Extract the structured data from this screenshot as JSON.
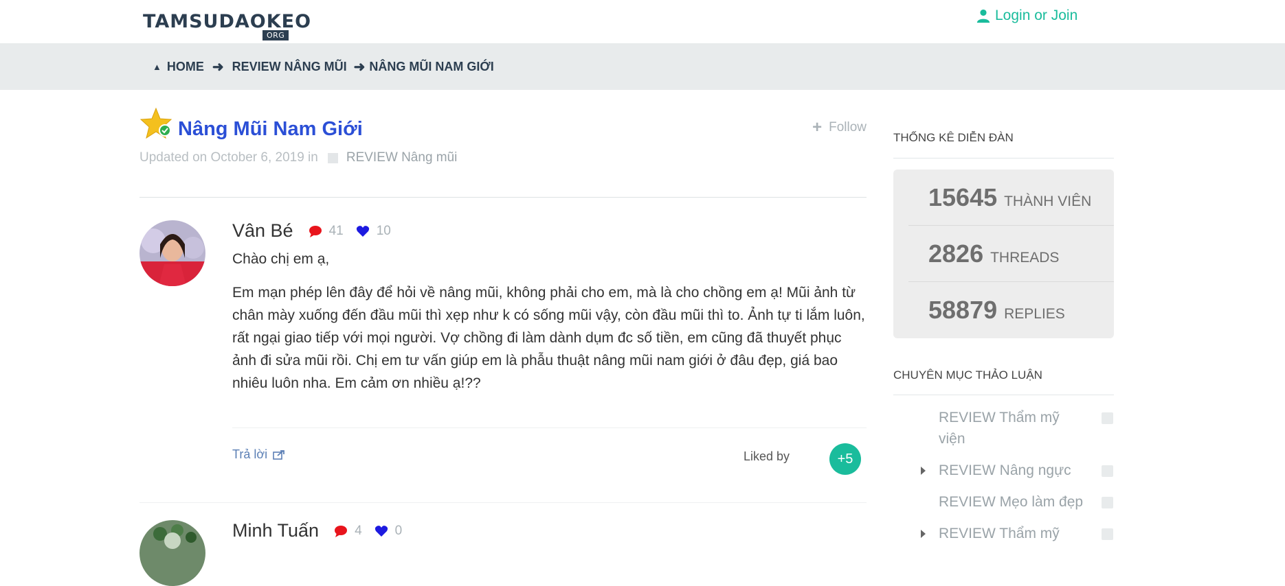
{
  "header": {
    "logo_main": "TAMSUDAOKEO",
    "logo_sub": "ORG",
    "login_label": "Login or Join",
    "accent_color": "#1abc9c"
  },
  "breadcrumb": {
    "items": [
      "HOME",
      "REVIEW Nâng mũi",
      "NÂNG MŨI NAM GIỚI"
    ]
  },
  "topic": {
    "title": "Nâng Mũi Nam Giới",
    "follow_label": "Follow",
    "updated_prefix": "Updated on October 6, 2019 in",
    "category": "REVIEW Nâng mũi"
  },
  "posts": [
    {
      "author": "Vân Bé",
      "comments": "41",
      "likes": "10",
      "greeting": "Chào chị em ạ,",
      "body": "Em mạn phép lên đây để hỏi về nâng mũi, không phải cho em, mà là cho chồng em ạ! Mũi ảnh từ chân mày xuống đến đầu mũi thì xẹp như k có sống mũi vậy, còn đầu mũi thì to. Ảnh tự ti lắm luôn, rất ngại giao tiếp với mọi người. Vợ chồng đi làm dành dụm đc số tiền, em cũng đã thuyết phục ảnh đi sửa mũi rồi. Chị em tư vấn giúp em là phẫu thuật nâng mũi nam giới ở đâu đẹp, giá bao nhiêu luôn nha. Em cảm ơn nhiều ạ!??",
      "reply_label": "Trả lời",
      "liked_by_label": "Liked by",
      "liked_more": "+5"
    },
    {
      "author": "Minh Tuấn",
      "comments": "4",
      "likes": "0"
    }
  ],
  "sidebar": {
    "stats_heading": "THỐNG KÊ DIỄN ĐÀN",
    "stats": [
      {
        "value": "15645",
        "label": "THÀNH VIÊN"
      },
      {
        "value": "2826",
        "label": "THREADS"
      },
      {
        "value": "58879",
        "label": "REPLIES"
      }
    ],
    "categories_heading": "CHUYÊN MỤC THẢO LUẬN",
    "categories": [
      {
        "label": "REVIEW Thẩm mỹ viện",
        "expandable": false
      },
      {
        "label": "REVIEW Nâng ngực",
        "expandable": true
      },
      {
        "label": "REVIEW Mẹo làm đẹp",
        "expandable": false
      },
      {
        "label": "REVIEW Thẩm mỹ",
        "expandable": true
      }
    ]
  }
}
